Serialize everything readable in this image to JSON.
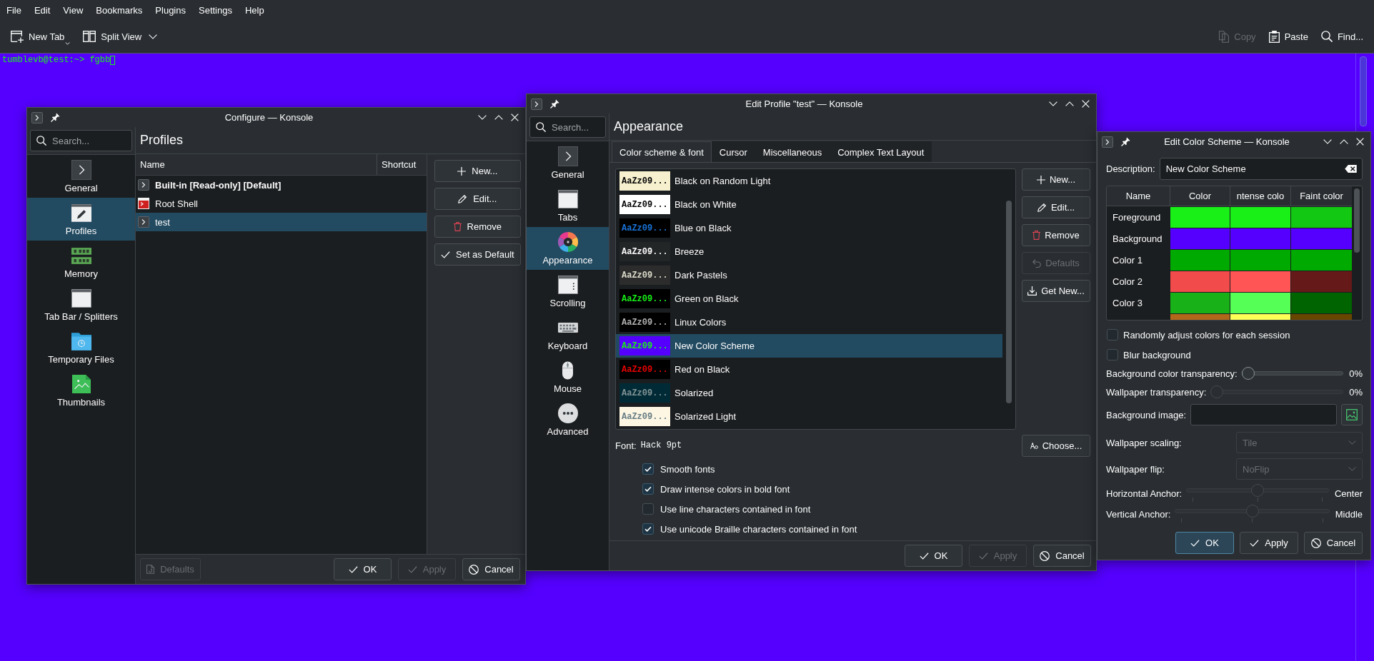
{
  "menu_bar": [
    "File",
    "Edit",
    "View",
    "Bookmarks",
    "Plugins",
    "Settings",
    "Help"
  ],
  "toolbar": {
    "left": [
      {
        "label": "New Tab"
      },
      {
        "label": "Split View"
      }
    ],
    "right": [
      {
        "label": "Copy",
        "disabled": true
      },
      {
        "label": "Paste",
        "disabled": false
      },
      {
        "label": "Find...",
        "disabled": false
      }
    ]
  },
  "terminal": {
    "line": "tumblevb@test:~> fgbb"
  },
  "configure_window": {
    "title": "Configure — Konsole",
    "search": {
      "placeholder": "Search..."
    },
    "sidebar": [
      {
        "label": "General",
        "selected": false
      },
      {
        "label": "Profiles",
        "selected": true
      },
      {
        "label": "Memory",
        "selected": false
      },
      {
        "label": "Tab Bar / Splitters",
        "selected": false
      },
      {
        "label": "Temporary Files",
        "selected": false
      },
      {
        "label": "Thumbnails",
        "selected": false
      }
    ],
    "page_title": "Profiles",
    "table": {
      "columns": [
        "Name",
        "Shortcut"
      ],
      "rows": [
        {
          "name": "Built-in [Read-only] [Default]",
          "kind": "profile",
          "default": true,
          "selected": false
        },
        {
          "name": "Root Shell",
          "kind": "root",
          "default": false,
          "selected": false
        },
        {
          "name": "test",
          "kind": "profile",
          "default": false,
          "selected": true
        }
      ]
    },
    "buttons": [
      {
        "label": "New...",
        "disabled": false
      },
      {
        "label": "Edit...",
        "disabled": false
      },
      {
        "label": "Remove",
        "disabled": false
      },
      {
        "label": "Set as Default",
        "disabled": false
      }
    ],
    "footer_buttons": [
      {
        "label": "Defaults",
        "disabled": true
      },
      {
        "label": "OK",
        "disabled": false
      },
      {
        "label": "Apply",
        "disabled": true
      },
      {
        "label": "Cancel",
        "disabled": false
      }
    ]
  },
  "edit_profile_window": {
    "title": "Edit Profile \"test\" — Konsole",
    "search": {
      "placeholder": "Search..."
    },
    "sidebar": [
      {
        "label": "General",
        "selected": false
      },
      {
        "label": "Tabs",
        "selected": false
      },
      {
        "label": "Appearance",
        "selected": true
      },
      {
        "label": "Scrolling",
        "selected": false
      },
      {
        "label": "Keyboard",
        "selected": false
      },
      {
        "label": "Mouse",
        "selected": false
      },
      {
        "label": "Advanced",
        "selected": false
      }
    ],
    "page_title": "Appearance",
    "tabs": [
      {
        "label": "Color scheme & font",
        "selected": true
      },
      {
        "label": "Cursor",
        "selected": false
      },
      {
        "label": "Miscellaneous",
        "selected": false
      },
      {
        "label": "Complex Text Layout",
        "selected": false
      }
    ],
    "color_schemes": [
      {
        "background": {
          "color": "#f6f0cf"
        },
        "preview": {
          "text": "AaZz09...",
          "color": "#000000"
        },
        "name": "Black on Random Light",
        "selected": false
      },
      {
        "background": {
          "color": "#ffffff"
        },
        "preview": {
          "text": "AaZz09...",
          "color": "#000000"
        },
        "name": "Black on White",
        "selected": false
      },
      {
        "background": {
          "color": "#000000"
        },
        "preview": {
          "text": "AaZz09...",
          "color": "#1873d8"
        },
        "name": "Blue on Black",
        "selected": false
      },
      {
        "background": {
          "color": "#232627"
        },
        "preview": {
          "text": "AaZz09...",
          "color": "#fcfcfc"
        },
        "name": "Breeze",
        "selected": false
      },
      {
        "background": {
          "color": "#2c2c2c"
        },
        "preview": {
          "text": "AaZz09...",
          "color": "#dcdccc"
        },
        "name": "Dark Pastels",
        "selected": false
      },
      {
        "background": {
          "color": "#000000"
        },
        "preview": {
          "text": "AaZz09...",
          "color": "#18f018"
        },
        "name": "Green on Black",
        "selected": false
      },
      {
        "background": {
          "color": "#000000"
        },
        "preview": {
          "text": "AaZz09...",
          "color": "#b2b2b2"
        },
        "name": "Linux Colors",
        "selected": false
      },
      {
        "background": {
          "color": "#5500ff"
        },
        "preview": {
          "text": "AaZz09...",
          "color": "#18f018"
        },
        "name": "New Color Scheme",
        "selected": true
      },
      {
        "background": {
          "color": "#000000"
        },
        "preview": {
          "text": "AaZz09...",
          "color": "#e80000"
        },
        "name": "Red on Black",
        "selected": false
      },
      {
        "background": {
          "color": "#002b36"
        },
        "preview": {
          "text": "AaZz09...",
          "color": "#839496"
        },
        "name": "Solarized",
        "selected": false
      },
      {
        "background": {
          "color": "#fdf6e3"
        },
        "preview": {
          "text": "AaZz09...",
          "color": "#657b83"
        },
        "name": "Solarized Light",
        "selected": false
      }
    ],
    "buttons": [
      {
        "label": "New...",
        "disabled": false
      },
      {
        "label": "Edit...",
        "disabled": false
      },
      {
        "label": "Remove",
        "disabled": false
      },
      {
        "label": "Defaults",
        "disabled": true
      },
      {
        "label": "Get New...",
        "disabled": false
      }
    ],
    "font": {
      "label": "Font:",
      "value": "Hack 9pt"
    },
    "choose_button": {
      "label": "Choose...",
      "disabled": false
    },
    "options": [
      {
        "label": "Smooth fonts",
        "checked": true
      },
      {
        "label": "Draw intense colors in bold font",
        "checked": true
      },
      {
        "label": "Use line characters contained in font",
        "checked": false
      },
      {
        "label": "Use unicode Braille characters contained in font",
        "checked": true
      }
    ],
    "footer_buttons": [
      {
        "label": "OK",
        "disabled": false
      },
      {
        "label": "Apply",
        "disabled": true
      },
      {
        "label": "Cancel",
        "disabled": false
      }
    ]
  },
  "color_scheme_window": {
    "title": "Edit Color Scheme — Konsole",
    "description": {
      "label": "Description:",
      "value": "New Color Scheme"
    },
    "colors_table": {
      "columns": [
        "Name",
        "Color",
        "ntense colo",
        "Faint color"
      ],
      "rows": [
        {
          "name": "Foreground",
          "swatches": [
            {
              "color": "#18f018"
            },
            {
              "color": "#18f018"
            },
            {
              "color": "#12c812"
            }
          ]
        },
        {
          "name": "Background",
          "swatches": [
            {
              "color": "#5500ff"
            },
            {
              "color": "#5500ff"
            },
            {
              "color": "#5500ff"
            }
          ]
        },
        {
          "name": "Color 1",
          "swatches": [
            {
              "color": "#00aa00"
            },
            {
              "color": "#00aa00"
            },
            {
              "color": "#00aa00"
            }
          ]
        },
        {
          "name": "Color 2",
          "swatches": [
            {
              "color": "#f24b4b"
            },
            {
              "color": "#ff5555"
            },
            {
              "color": "#651919"
            }
          ]
        },
        {
          "name": "Color 3",
          "swatches": [
            {
              "color": "#18b218"
            },
            {
              "color": "#55ff55"
            },
            {
              "color": "#006400"
            }
          ]
        },
        {
          "swatches": [
            {
              "color": "#b2681a"
            },
            {
              "color": "#ffff55"
            },
            {
              "color": "#684600"
            }
          ]
        }
      ]
    },
    "options": [
      {
        "label": "Randomly adjust colors for each session",
        "checked": false
      },
      {
        "label": "Blur background",
        "checked": false
      }
    ],
    "transparency": [
      {
        "label": "Background color transparency:",
        "level": 0,
        "reading": "0%",
        "disabled": false
      },
      {
        "label": "Wallpaper transparency:",
        "level": 0,
        "reading": "0%",
        "disabled": true
      }
    ],
    "background_image": {
      "label": "Background image:"
    },
    "dropdowns": [
      {
        "label": "Wallpaper scaling:",
        "value": "Tile",
        "disabled": true
      },
      {
        "label": "Wallpaper flip:",
        "value": "NoFlip",
        "disabled": true
      }
    ],
    "anchors": [
      {
        "label": "Horizontal Anchor:",
        "level": 0.5,
        "reading": "Center",
        "disabled": true
      },
      {
        "label": "Vertical Anchor:",
        "level": 0.5,
        "reading": "Middle",
        "disabled": true
      }
    ],
    "buttons": [
      {
        "label": "OK",
        "default": true
      },
      {
        "label": "Apply",
        "default": false
      },
      {
        "label": "Cancel",
        "default": false
      }
    ]
  }
}
